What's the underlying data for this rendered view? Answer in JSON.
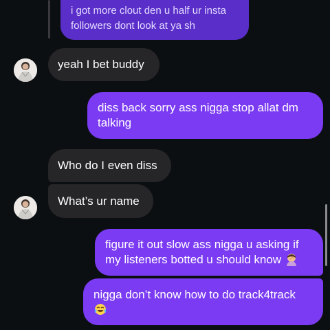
{
  "messages": [
    {
      "id": "m1",
      "side": "out",
      "style": "reply",
      "text": "i got more clout den u half ur insta followers dont look at ya sh"
    },
    {
      "id": "m2",
      "side": "in",
      "text": "yeah I bet buddy",
      "avatar": "sender-avatar"
    },
    {
      "id": "m3",
      "side": "out",
      "text": "diss back sorry ass nigga stop allat dm talking"
    },
    {
      "id": "m4",
      "side": "in",
      "text": "Who do I even diss"
    },
    {
      "id": "m5",
      "side": "in",
      "text": "What’s ur name",
      "avatar": "sender-avatar"
    },
    {
      "id": "m6",
      "side": "out",
      "text": "figure it out slow ass nigga u asking if my listeners botted u should know",
      "emoji": "person-facepalming-emoji"
    },
    {
      "id": "m7",
      "side": "out",
      "text": "nigga don’t know how to do track4track",
      "emoji": "face-with-tears-of-joy-emoji"
    }
  ],
  "colors": {
    "background": "#0c0f12",
    "incoming_bubble": "#262628",
    "outgoing_bubble": "#7b3bf2",
    "reply_bubble": "#5a2ec9",
    "text": "#ffffff"
  }
}
